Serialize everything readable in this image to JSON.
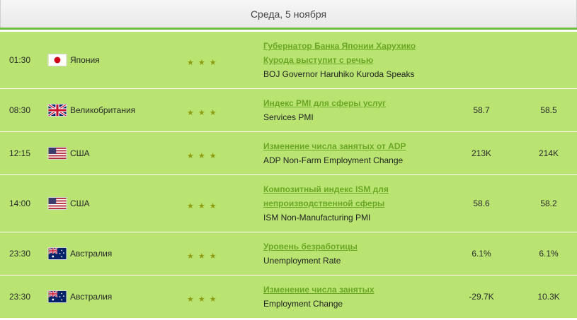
{
  "header": {
    "date": "Среда, 5 ноября"
  },
  "star_symbol": "★",
  "rows": [
    {
      "time": "01:30",
      "flag_icon": "japan-flag-icon",
      "country": "Япония",
      "importance": 3,
      "event_ru_line1": "Губернатор Банка Японии Харухико",
      "event_ru_line2": "Курода выступит с речью",
      "event_en": "BOJ Governor Haruhiko Kuroda Speaks",
      "actual": "",
      "forecast": ""
    },
    {
      "time": "08:30",
      "flag_icon": "uk-flag-icon",
      "country": "Великобритания",
      "importance": 3,
      "event_ru_line1": "Индекс PMI для сферы услуг",
      "event_ru_line2": "",
      "event_en": "Services PMI",
      "actual": "58.7",
      "forecast": "58.5"
    },
    {
      "time": "12:15",
      "flag_icon": "usa-flag-icon",
      "country": "США",
      "importance": 3,
      "event_ru_line1": "Изменение числа занятых от ADP",
      "event_ru_line2": "",
      "event_en": "ADP Non-Farm Employment Change",
      "actual": "213K",
      "forecast": "214K"
    },
    {
      "time": "14:00",
      "flag_icon": "usa-flag-icon",
      "country": "США",
      "importance": 3,
      "event_ru_line1": "Композитный индекс ISM для",
      "event_ru_line2": "непроизводственной сферы",
      "event_en": "ISM Non-Manufacturing PMI",
      "actual": "58.6",
      "forecast": "58.2"
    },
    {
      "time": "23:30",
      "flag_icon": "australia-flag-icon",
      "country": "Австралия",
      "importance": 3,
      "event_ru_line1": "Уровень безработицы",
      "event_ru_line2": "",
      "event_en": "Unemployment Rate",
      "actual": "6.1%",
      "forecast": "6.1%"
    },
    {
      "time": "23:30",
      "flag_icon": "australia-flag-icon",
      "country": "Австралия",
      "importance": 3,
      "event_ru_line1": "Изменение числа занятых",
      "event_ru_line2": "",
      "event_en": "Employment Change",
      "actual": "-29.7K",
      "forecast": "10.3K"
    }
  ],
  "colors": {
    "row_bg": "#b9e472",
    "link": "#6aa824",
    "accent": "#6cbf3a",
    "star": "#8c9c10"
  }
}
